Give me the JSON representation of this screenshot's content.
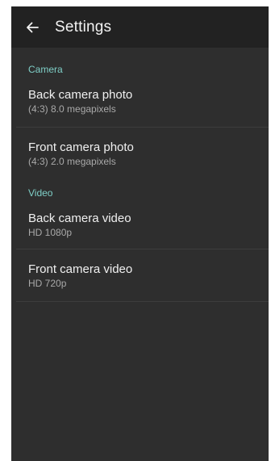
{
  "app_bar": {
    "back_icon": "arrow-left-icon",
    "title": "Settings"
  },
  "colors": {
    "background": "#2e2e2e",
    "app_bar": "#222222",
    "accent": "#7fcfc7",
    "title_text": "#f0f0f0",
    "summary_text": "#a9a9a9"
  },
  "sections": [
    {
      "header": "Camera",
      "items": [
        {
          "title": "Back camera photo",
          "summary": "(4:3) 8.0 megapixels"
        },
        {
          "title": "Front camera photo",
          "summary": "(4:3) 2.0 megapixels"
        }
      ]
    },
    {
      "header": "Video",
      "items": [
        {
          "title": "Back camera video",
          "summary": "HD 1080p"
        },
        {
          "title": "Front camera video",
          "summary": "HD 720p"
        }
      ]
    }
  ]
}
